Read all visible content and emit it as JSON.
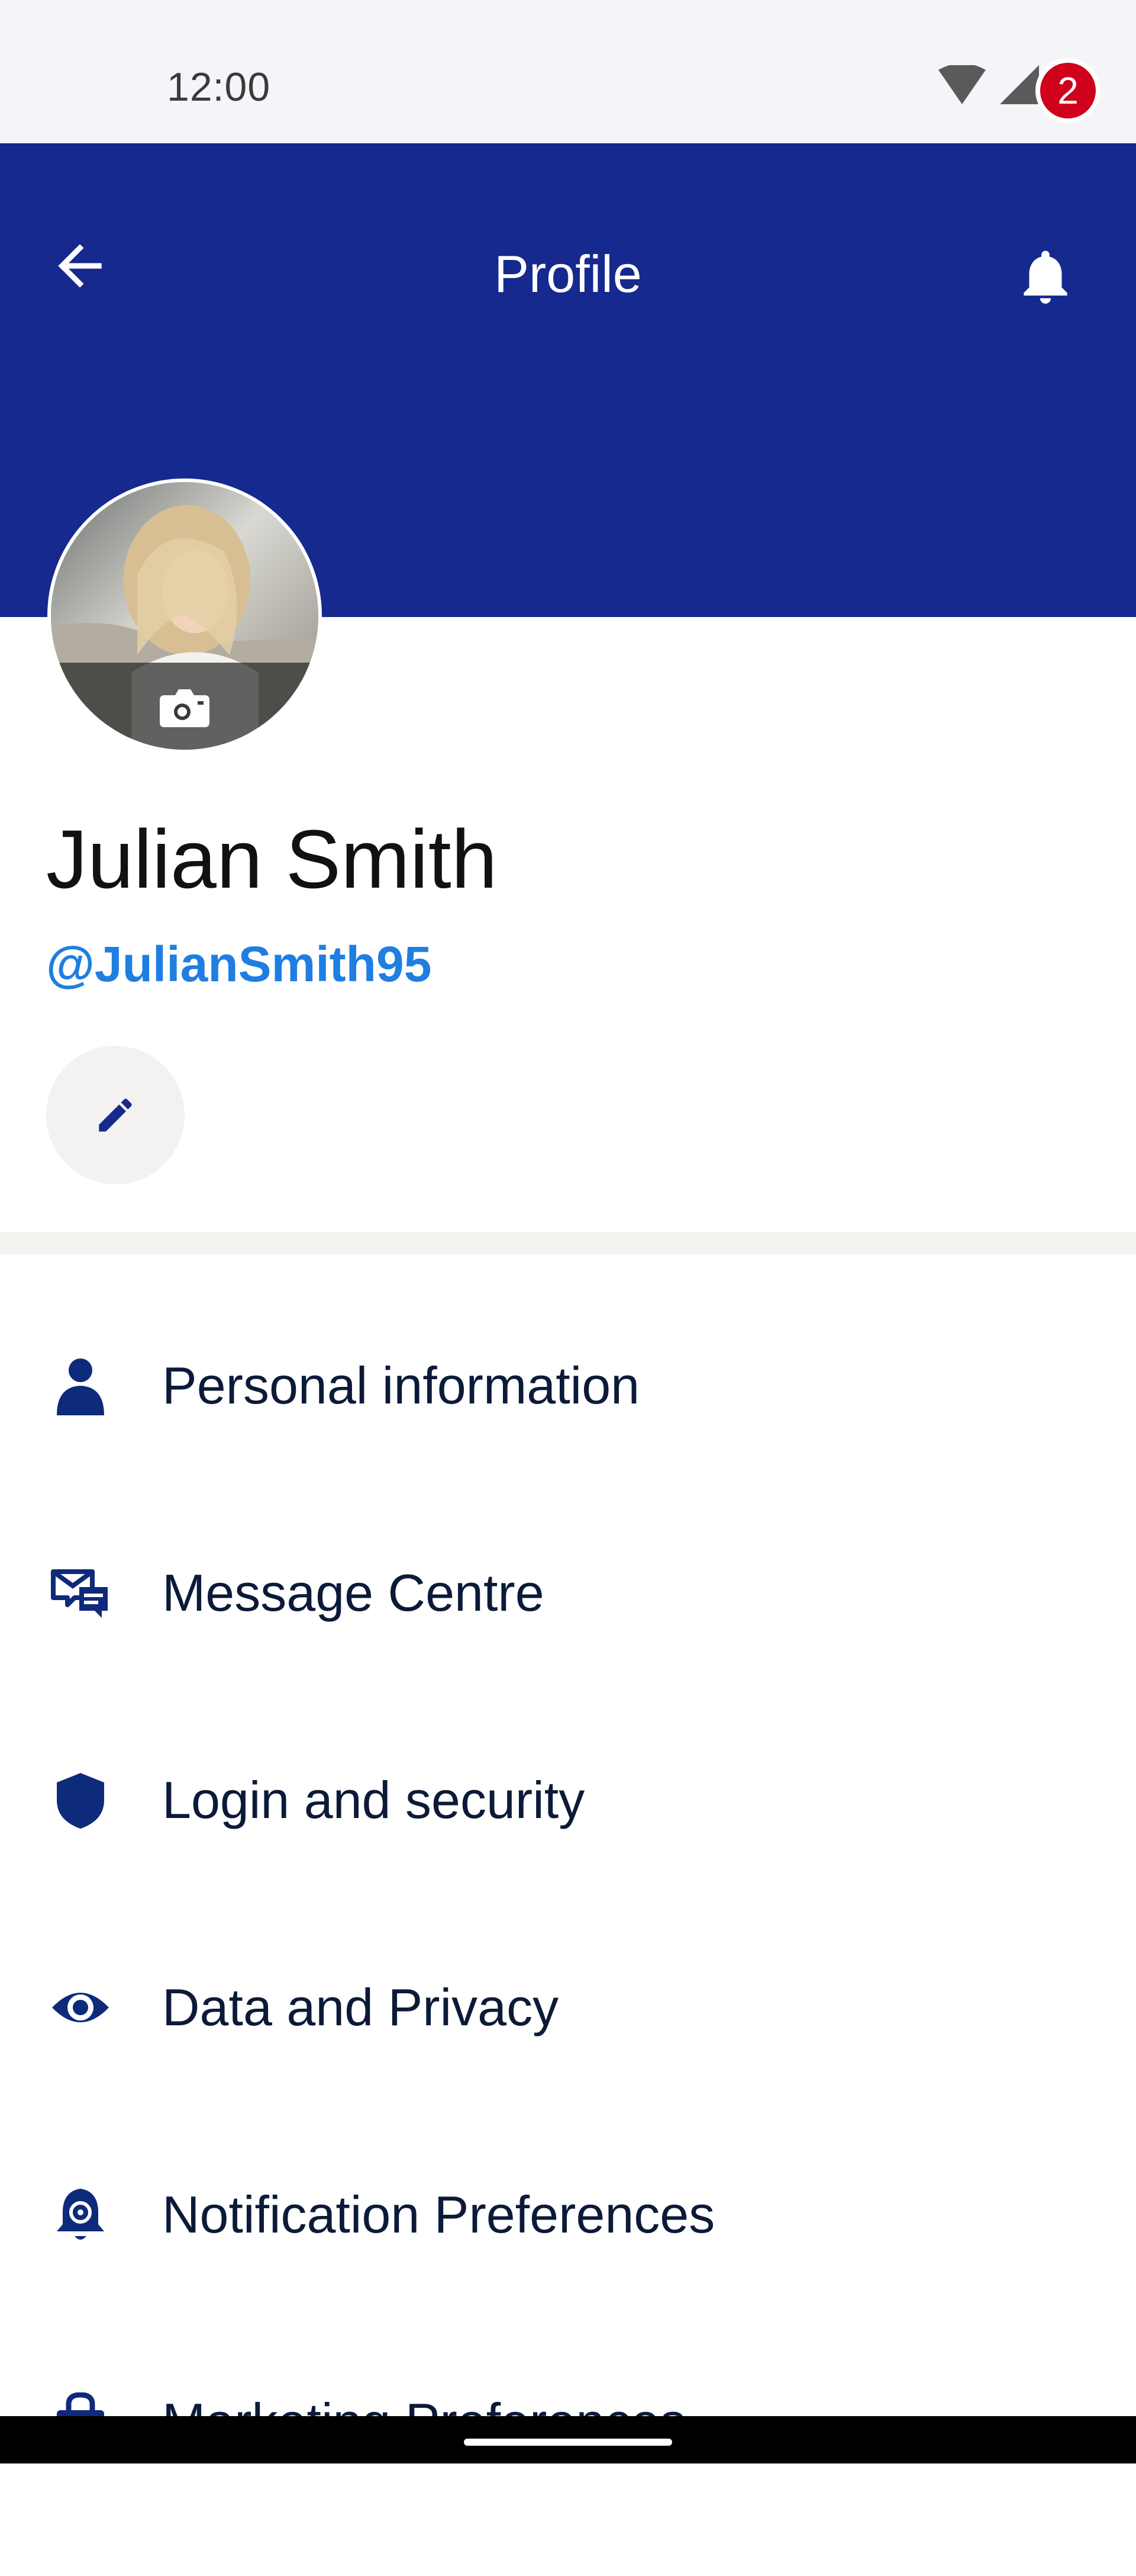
{
  "status_bar": {
    "time": "12:00",
    "icons": [
      "wifi-icon",
      "signal-icon",
      "battery-icon"
    ]
  },
  "header": {
    "title": "Profile",
    "back_icon": "arrow-left-icon",
    "notifications_icon": "bell-icon",
    "notification_count": "2",
    "background_color": "#15298e"
  },
  "profile": {
    "name": "Julian Smith",
    "handle": "@JulianSmith95",
    "avatar_icon": "camera-icon",
    "edit_icon": "pencil-icon",
    "handle_color": "#1f7ee0"
  },
  "menu": {
    "items": [
      {
        "label": "Personal information",
        "icon": "person-icon"
      },
      {
        "label": "Message Centre",
        "icon": "message-icon"
      },
      {
        "label": "Login and security",
        "icon": "shield-icon"
      },
      {
        "label": "Data and Privacy",
        "icon": "eye-icon"
      },
      {
        "label": "Notification Preferences",
        "icon": "bell-gear-icon"
      },
      {
        "label": "Marketing Preferences",
        "icon": "shopping-bag-icon"
      }
    ],
    "icon_color": "#0e2a7a"
  }
}
